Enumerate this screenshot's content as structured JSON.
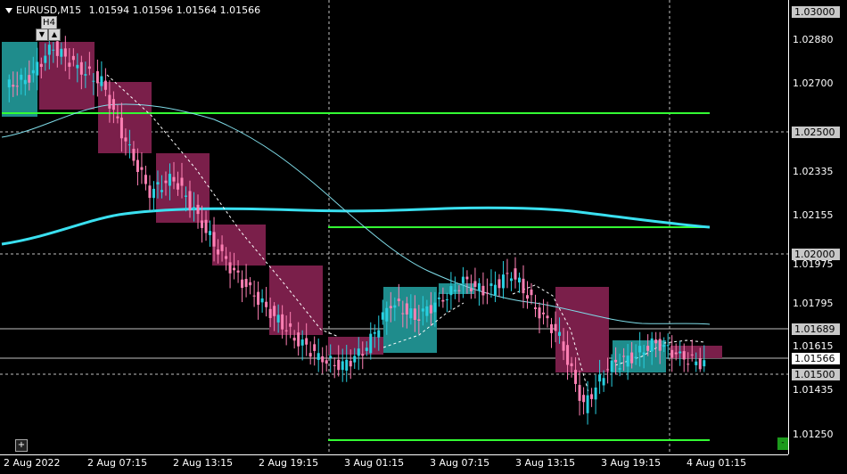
{
  "header": {
    "symbol_timeframe": "EURUSD,M15",
    "ohlc": "1.01594 1.01596 1.01564 1.01566",
    "menu_icon": "triangle-down-icon"
  },
  "timeframe_widget": {
    "label": "H4",
    "prev_icon": "triangle-down-icon",
    "next_icon": "triangle-up-icon",
    "prev_glyph": "▼",
    "next_glyph": "▲"
  },
  "price_axis": {
    "labels": [
      "1.02880",
      "1.02700",
      "1.02335",
      "1.02155",
      "1.01975",
      "1.01795",
      "1.01615",
      "1.01435",
      "1.01250"
    ],
    "boxed_levels": [
      "1.03000",
      "1.02500",
      "1.02000",
      "1.01689",
      "1.01500"
    ],
    "current_price": "1.01566"
  },
  "time_axis": {
    "labels": [
      "2 Aug 2022",
      "2 Aug 07:15",
      "2 Aug 13:15",
      "2 Aug 19:15",
      "3 Aug 01:15",
      "3 Aug 07:15",
      "3 Aug 13:15",
      "3 Aug 19:15",
      "4 Aug 01:15"
    ]
  },
  "controls": {
    "crosshair_glyph": "+",
    "status_glyph": "-"
  },
  "colors": {
    "background": "#000000",
    "bull_candle": "#28d0e0",
    "bear_candle": "#ff80b4",
    "bull_zone": "#1f8c8c",
    "bear_zone": "#7a1f4a",
    "support_resistance": "#33ff33",
    "ma_slow": "#3ae0f0",
    "ma_fast": "#7fdce8",
    "grid": "#c0c0c0"
  },
  "chart_data": {
    "type": "candlestick",
    "symbol": "EURUSD",
    "timeframe": "M15",
    "y_range": [
      1.0121,
      1.0303
    ],
    "horizontal_levels": [
      1.0258,
      1.0211,
      1.0124
    ],
    "candles": [
      {
        "t": 0,
        "o": 1.0268,
        "h": 1.0295,
        "l": 1.0262,
        "c": 1.0272
      },
      {
        "t": 1,
        "o": 1.0272,
        "h": 1.0294,
        "l": 1.0266,
        "c": 1.0285
      },
      {
        "t": 2,
        "o": 1.0284,
        "h": 1.029,
        "l": 1.027,
        "c": 1.0276
      },
      {
        "t": 3,
        "o": 1.0276,
        "h": 1.0285,
        "l": 1.0264,
        "c": 1.027
      },
      {
        "t": 4,
        "o": 1.027,
        "h": 1.0278,
        "l": 1.024,
        "c": 1.0246
      },
      {
        "t": 5,
        "o": 1.0246,
        "h": 1.0255,
        "l": 1.0218,
        "c": 1.0226
      },
      {
        "t": 6,
        "o": 1.0226,
        "h": 1.024,
        "l": 1.0212,
        "c": 1.0232
      },
      {
        "t": 7,
        "o": 1.0232,
        "h": 1.0238,
        "l": 1.021,
        "c": 1.0216
      },
      {
        "t": 8,
        "o": 1.0216,
        "h": 1.0225,
        "l": 1.0196,
        "c": 1.02
      },
      {
        "t": 9,
        "o": 1.02,
        "h": 1.0208,
        "l": 1.0182,
        "c": 1.0188
      },
      {
        "t": 10,
        "o": 1.0188,
        "h": 1.0192,
        "l": 1.0172,
        "c": 1.0178
      },
      {
        "t": 11,
        "o": 1.0178,
        "h": 1.0182,
        "l": 1.0162,
        "c": 1.0168
      },
      {
        "t": 12,
        "o": 1.0168,
        "h": 1.0176,
        "l": 1.0154,
        "c": 1.016
      },
      {
        "t": 13,
        "o": 1.016,
        "h": 1.0166,
        "l": 1.015,
        "c": 1.0156
      },
      {
        "t": 14,
        "o": 1.0156,
        "h": 1.0168,
        "l": 1.015,
        "c": 1.0164
      },
      {
        "t": 15,
        "o": 1.0164,
        "h": 1.0186,
        "l": 1.0158,
        "c": 1.0182
      },
      {
        "t": 16,
        "o": 1.0182,
        "h": 1.0192,
        "l": 1.017,
        "c": 1.0176
      },
      {
        "t": 17,
        "o": 1.0176,
        "h": 1.0186,
        "l": 1.0162,
        "c": 1.0182
      },
      {
        "t": 18,
        "o": 1.0182,
        "h": 1.0196,
        "l": 1.0178,
        "c": 1.019
      },
      {
        "t": 19,
        "o": 1.019,
        "h": 1.0208,
        "l": 1.018,
        "c": 1.0186
      },
      {
        "t": 20,
        "o": 1.0186,
        "h": 1.0212,
        "l": 1.0182,
        "c": 1.0194
      },
      {
        "t": 21,
        "o": 1.0194,
        "h": 1.02,
        "l": 1.0176,
        "c": 1.018
      },
      {
        "t": 22,
        "o": 1.018,
        "h": 1.0184,
        "l": 1.016,
        "c": 1.0168
      },
      {
        "t": 23,
        "o": 1.0168,
        "h": 1.0172,
        "l": 1.013,
        "c": 1.014
      },
      {
        "t": 24,
        "o": 1.014,
        "h": 1.016,
        "l": 1.0124,
        "c": 1.0156
      },
      {
        "t": 25,
        "o": 1.0156,
        "h": 1.0166,
        "l": 1.0148,
        "c": 1.016
      },
      {
        "t": 26,
        "o": 1.016,
        "h": 1.017,
        "l": 1.0152,
        "c": 1.0166
      },
      {
        "t": 27,
        "o": 1.0166,
        "h": 1.017,
        "l": 1.0154,
        "c": 1.016
      },
      {
        "t": 28,
        "o": 1.016,
        "h": 1.0168,
        "l": 1.0154,
        "c": 1.0157
      }
    ]
  }
}
